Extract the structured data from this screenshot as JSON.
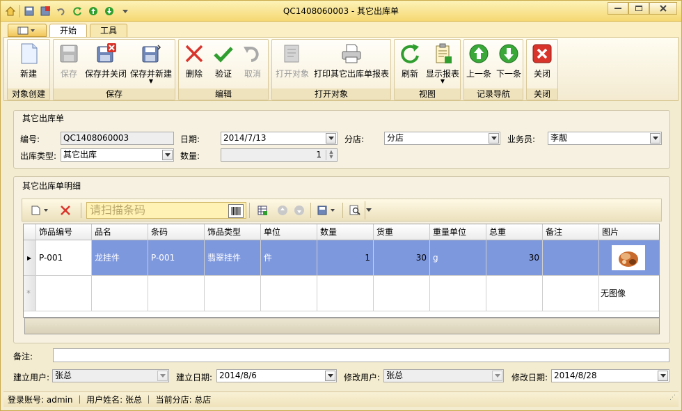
{
  "window": {
    "title": "QC1408060003 - 其它出库单"
  },
  "tabs": [
    {
      "label": "开始",
      "active": true
    },
    {
      "label": "工具",
      "active": false
    }
  ],
  "ribbon": {
    "groups": [
      {
        "label": "对象创建",
        "buttons": [
          {
            "label": "新建",
            "icon": "new-document-icon",
            "enabled": true
          }
        ]
      },
      {
        "label": "保存",
        "buttons": [
          {
            "label": "保存",
            "icon": "save-icon",
            "enabled": false
          },
          {
            "label": "保存并关闭",
            "icon": "save-close-icon",
            "enabled": true
          },
          {
            "label": "保存并新建",
            "icon": "save-new-icon",
            "enabled": true
          }
        ]
      },
      {
        "label": "编辑",
        "buttons": [
          {
            "label": "删除",
            "icon": "delete-icon",
            "enabled": true
          },
          {
            "label": "验证",
            "icon": "check-icon",
            "enabled": true
          },
          {
            "label": "取消",
            "icon": "undo-icon",
            "enabled": false
          }
        ]
      },
      {
        "label": "打开对象",
        "buttons": [
          {
            "label": "打开对象",
            "icon": "open-object-icon",
            "enabled": false
          },
          {
            "label": "打印其它出库单报表",
            "icon": "printer-icon",
            "enabled": true
          }
        ]
      },
      {
        "label": "视图",
        "buttons": [
          {
            "label": "刷新",
            "icon": "refresh-icon",
            "enabled": true
          },
          {
            "label": "显示报表",
            "icon": "report-icon",
            "enabled": true
          }
        ]
      },
      {
        "label": "记录导航",
        "buttons": [
          {
            "label": "上一条",
            "icon": "arrow-up-icon",
            "enabled": true
          },
          {
            "label": "下一条",
            "icon": "arrow-down-icon",
            "enabled": true
          }
        ]
      },
      {
        "label": "关闭",
        "buttons": [
          {
            "label": "关闭",
            "icon": "close-icon",
            "enabled": true
          }
        ]
      }
    ]
  },
  "form": {
    "section_title": "其它出库单",
    "number_label": "编号:",
    "number_value": "QC1408060003",
    "date_label": "日期:",
    "date_value": "2014/7/13",
    "branch_label": "分店:",
    "branch_value": "分店",
    "salesman_label": "业务员:",
    "salesman_value": "李靓",
    "type_label": "出库类型:",
    "type_value": "其它出库",
    "qty_label": "数量:",
    "qty_value": "1"
  },
  "detail": {
    "section_title": "其它出库单明细",
    "scan_placeholder": "请扫描条码",
    "columns": [
      "饰品编号",
      "品名",
      "条码",
      "饰品类型",
      "单位",
      "数量",
      "货重",
      "重量单位",
      "总重",
      "备注",
      "图片"
    ],
    "rows": [
      {
        "id": "P-001",
        "name": "龙挂件",
        "barcode": "P-001",
        "type": "翡翠挂件",
        "unit": "件",
        "qty": "1",
        "weight": "30",
        "weight_unit": "g",
        "total": "30",
        "note": "",
        "image": ""
      }
    ],
    "no_image_text": "无图像"
  },
  "footer": {
    "remark_label": "备注:",
    "remark_value": "",
    "creator_label": "建立用户:",
    "creator_value": "张总",
    "create_date_label": "建立日期:",
    "create_date_value": "2014/8/6",
    "modifier_label": "修改用户:",
    "modifier_value": "张总",
    "modify_date_label": "修改日期:",
    "modify_date_value": "2014/8/28"
  },
  "status": {
    "text": "登录账号: admin ｜ 用户姓名: 张总 ｜ 当前分店: 总店"
  },
  "colors": {
    "selected_row": "#7e98de",
    "title_bar": "#f5d873",
    "close_red": "#d9342b",
    "nav_green": "#2f9e2f"
  }
}
